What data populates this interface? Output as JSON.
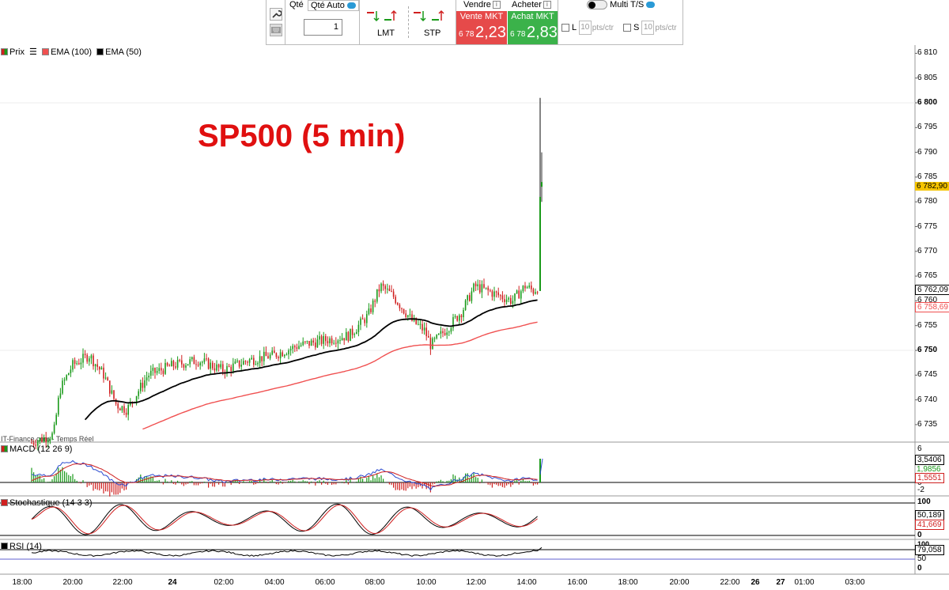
{
  "toolbar": {
    "qty_label": "Qté",
    "qty_auto_label": "Qté Auto",
    "qty_value": "1",
    "lmt_label": "LMT",
    "stp_label": "STP",
    "sell_header": "Vendre",
    "buy_header": "Acheter",
    "info_glyph": "i",
    "sell_title": "Vente MKT",
    "sell_small": "6 78",
    "sell_big": "2,23",
    "buy_title": "Achat MKT",
    "buy_small": "6 78",
    "buy_big": "2,83",
    "multi_ts_label": "Multi T/S",
    "l_label": "L",
    "s_label": "S",
    "l_value": "10",
    "s_value": "10",
    "pts_label": "pts/ctr",
    "sell_color": "#e64a4a",
    "buy_color": "#3bb24a"
  },
  "chart": {
    "annotation": "SP500 (5 min)",
    "source": "IT-Finance.com - Temps Réel",
    "legend": {
      "price": "Prix",
      "ema100": "EMA (100)",
      "ema50": "EMA (50)"
    },
    "price_axis": [
      "6 810",
      "6 805",
      "6 800",
      "6 795",
      "6 790",
      "6 785",
      "6 780",
      "6 775",
      "6 770",
      "6 765",
      "6 760",
      "6 755",
      "6 750",
      "6 745",
      "6 740",
      "6 735"
    ],
    "price_axis_bold": [
      "6 800",
      "6 750"
    ],
    "price_tags": {
      "last": "6 782,90",
      "ema50": "6 762,09",
      "ema100": "6 758,69"
    },
    "time_axis": [
      "18:00",
      "20:00",
      "22:00",
      "24",
      "02:00",
      "04:00",
      "06:00",
      "08:00",
      "10:00",
      "12:00",
      "14:00",
      "16:00",
      "18:00",
      "20:00",
      "22:00",
      "26",
      "27",
      "01:00",
      "03:00"
    ],
    "colors": {
      "up": "#1a9a1a",
      "down": "#d02020",
      "ema100": "#f05050",
      "ema50": "#000000",
      "last_tag": "#f5c400"
    }
  },
  "macd": {
    "label": "MACD (12 26 9)",
    "axis": [
      "6",
      "0",
      "-2"
    ],
    "tags": [
      "3,5406",
      "1,9856",
      "1,5551"
    ]
  },
  "stoch": {
    "label": "Stochastique (14 3 3)",
    "axis": [
      "100",
      "0"
    ],
    "tags": [
      "50,189",
      "41,669"
    ]
  },
  "rsi": {
    "label": "RSI (14)",
    "axis": [
      "100",
      "50",
      "0"
    ],
    "tags": [
      "79,058"
    ]
  },
  "chart_data": {
    "type": "candlestick",
    "title": "SP500 (5 min)",
    "ylim": [
      6733,
      6811
    ],
    "x_ticks": [
      "18:00",
      "20:00",
      "22:00",
      "24",
      "02:00",
      "04:00",
      "06:00",
      "08:00",
      "10:00",
      "12:00",
      "14:00",
      "16:00",
      "18:00",
      "20:00",
      "22:00",
      "26",
      "27",
      "01:00",
      "03:00"
    ],
    "price_path": [
      [
        "17:40",
        6730
      ],
      [
        "19:15",
        6733
      ],
      [
        "19:30",
        6742
      ],
      [
        "20:00",
        6747
      ],
      [
        "20:40",
        6749
      ],
      [
        "21:15",
        6745
      ],
      [
        "21:45",
        6739
      ],
      [
        "22:10",
        6738
      ],
      [
        "23:00",
        6745
      ],
      [
        "00:00",
        6747
      ],
      [
        "01:00",
        6748
      ],
      [
        "02:00",
        6746
      ],
      [
        "03:00",
        6748
      ],
      [
        "04:00",
        6749
      ],
      [
        "05:00",
        6751
      ],
      [
        "06:00",
        6752
      ],
      [
        "07:00",
        6753
      ],
      [
        "07:45",
        6757
      ],
      [
        "08:15",
        6763
      ],
      [
        "08:45",
        6761
      ],
      [
        "09:30",
        6756
      ],
      [
        "10:00",
        6754
      ],
      [
        "10:15",
        6751
      ],
      [
        "11:00",
        6755
      ],
      [
        "11:30",
        6758
      ],
      [
        "12:00",
        6763
      ],
      [
        "13:00",
        6761
      ],
      [
        "13:30",
        6760
      ],
      [
        "14:00",
        6763
      ],
      [
        "14:20",
        6762
      ],
      [
        "14:35",
        6763
      ],
      [
        "14:40",
        6781
      ],
      [
        "14:45",
        6782.9
      ]
    ],
    "spike_high": 6801,
    "last": 6782.9,
    "series": [
      {
        "name": "EMA (50)",
        "last": 6762.09
      },
      {
        "name": "EMA (100)",
        "last": 6758.69
      }
    ]
  }
}
